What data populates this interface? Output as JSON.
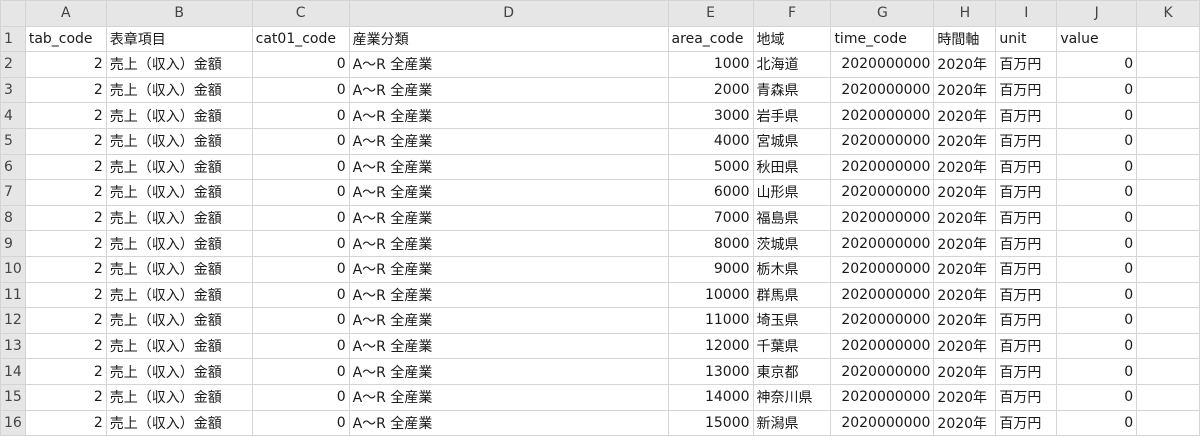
{
  "columns": [
    "A",
    "B",
    "C",
    "D",
    "E",
    "F",
    "G",
    "H",
    "I",
    "J",
    "K"
  ],
  "headers": [
    "tab_code",
    "表章項目",
    "cat01_code",
    "産業分類",
    "area_code",
    "地域",
    "time_code",
    "時間軸",
    "unit",
    "value",
    ""
  ],
  "rows": [
    [
      "2",
      "売上（収入）金額",
      "0",
      "A～R 全産業",
      "1000",
      "北海道",
      "2020000000",
      "2020年",
      "百万円",
      "0",
      ""
    ],
    [
      "2",
      "売上（収入）金額",
      "0",
      "A～R 全産業",
      "2000",
      "青森県",
      "2020000000",
      "2020年",
      "百万円",
      "0",
      ""
    ],
    [
      "2",
      "売上（収入）金額",
      "0",
      "A～R 全産業",
      "3000",
      "岩手県",
      "2020000000",
      "2020年",
      "百万円",
      "0",
      ""
    ],
    [
      "2",
      "売上（収入）金額",
      "0",
      "A～R 全産業",
      "4000",
      "宮城県",
      "2020000000",
      "2020年",
      "百万円",
      "0",
      ""
    ],
    [
      "2",
      "売上（収入）金額",
      "0",
      "A～R 全産業",
      "5000",
      "秋田県",
      "2020000000",
      "2020年",
      "百万円",
      "0",
      ""
    ],
    [
      "2",
      "売上（収入）金額",
      "0",
      "A～R 全産業",
      "6000",
      "山形県",
      "2020000000",
      "2020年",
      "百万円",
      "0",
      ""
    ],
    [
      "2",
      "売上（収入）金額",
      "0",
      "A～R 全産業",
      "7000",
      "福島県",
      "2020000000",
      "2020年",
      "百万円",
      "0",
      ""
    ],
    [
      "2",
      "売上（収入）金額",
      "0",
      "A～R 全産業",
      "8000",
      "茨城県",
      "2020000000",
      "2020年",
      "百万円",
      "0",
      ""
    ],
    [
      "2",
      "売上（収入）金額",
      "0",
      "A～R 全産業",
      "9000",
      "栃木県",
      "2020000000",
      "2020年",
      "百万円",
      "0",
      ""
    ],
    [
      "2",
      "売上（収入）金額",
      "0",
      "A～R 全産業",
      "10000",
      "群馬県",
      "2020000000",
      "2020年",
      "百万円",
      "0",
      ""
    ],
    [
      "2",
      "売上（収入）金額",
      "0",
      "A～R 全産業",
      "11000",
      "埼玉県",
      "2020000000",
      "2020年",
      "百万円",
      "0",
      ""
    ],
    [
      "2",
      "売上（収入）金額",
      "0",
      "A～R 全産業",
      "12000",
      "千葉県",
      "2020000000",
      "2020年",
      "百万円",
      "0",
      ""
    ],
    [
      "2",
      "売上（収入）金額",
      "0",
      "A～R 全産業",
      "13000",
      "東京都",
      "2020000000",
      "2020年",
      "百万円",
      "0",
      ""
    ],
    [
      "2",
      "売上（収入）金額",
      "0",
      "A～R 全産業",
      "14000",
      "神奈川県",
      "2020000000",
      "2020年",
      "百万円",
      "0",
      ""
    ],
    [
      "2",
      "売上（収入）金額",
      "0",
      "A～R 全産業",
      "15000",
      "新潟県",
      "2020000000",
      "2020年",
      "百万円",
      "0",
      ""
    ]
  ]
}
